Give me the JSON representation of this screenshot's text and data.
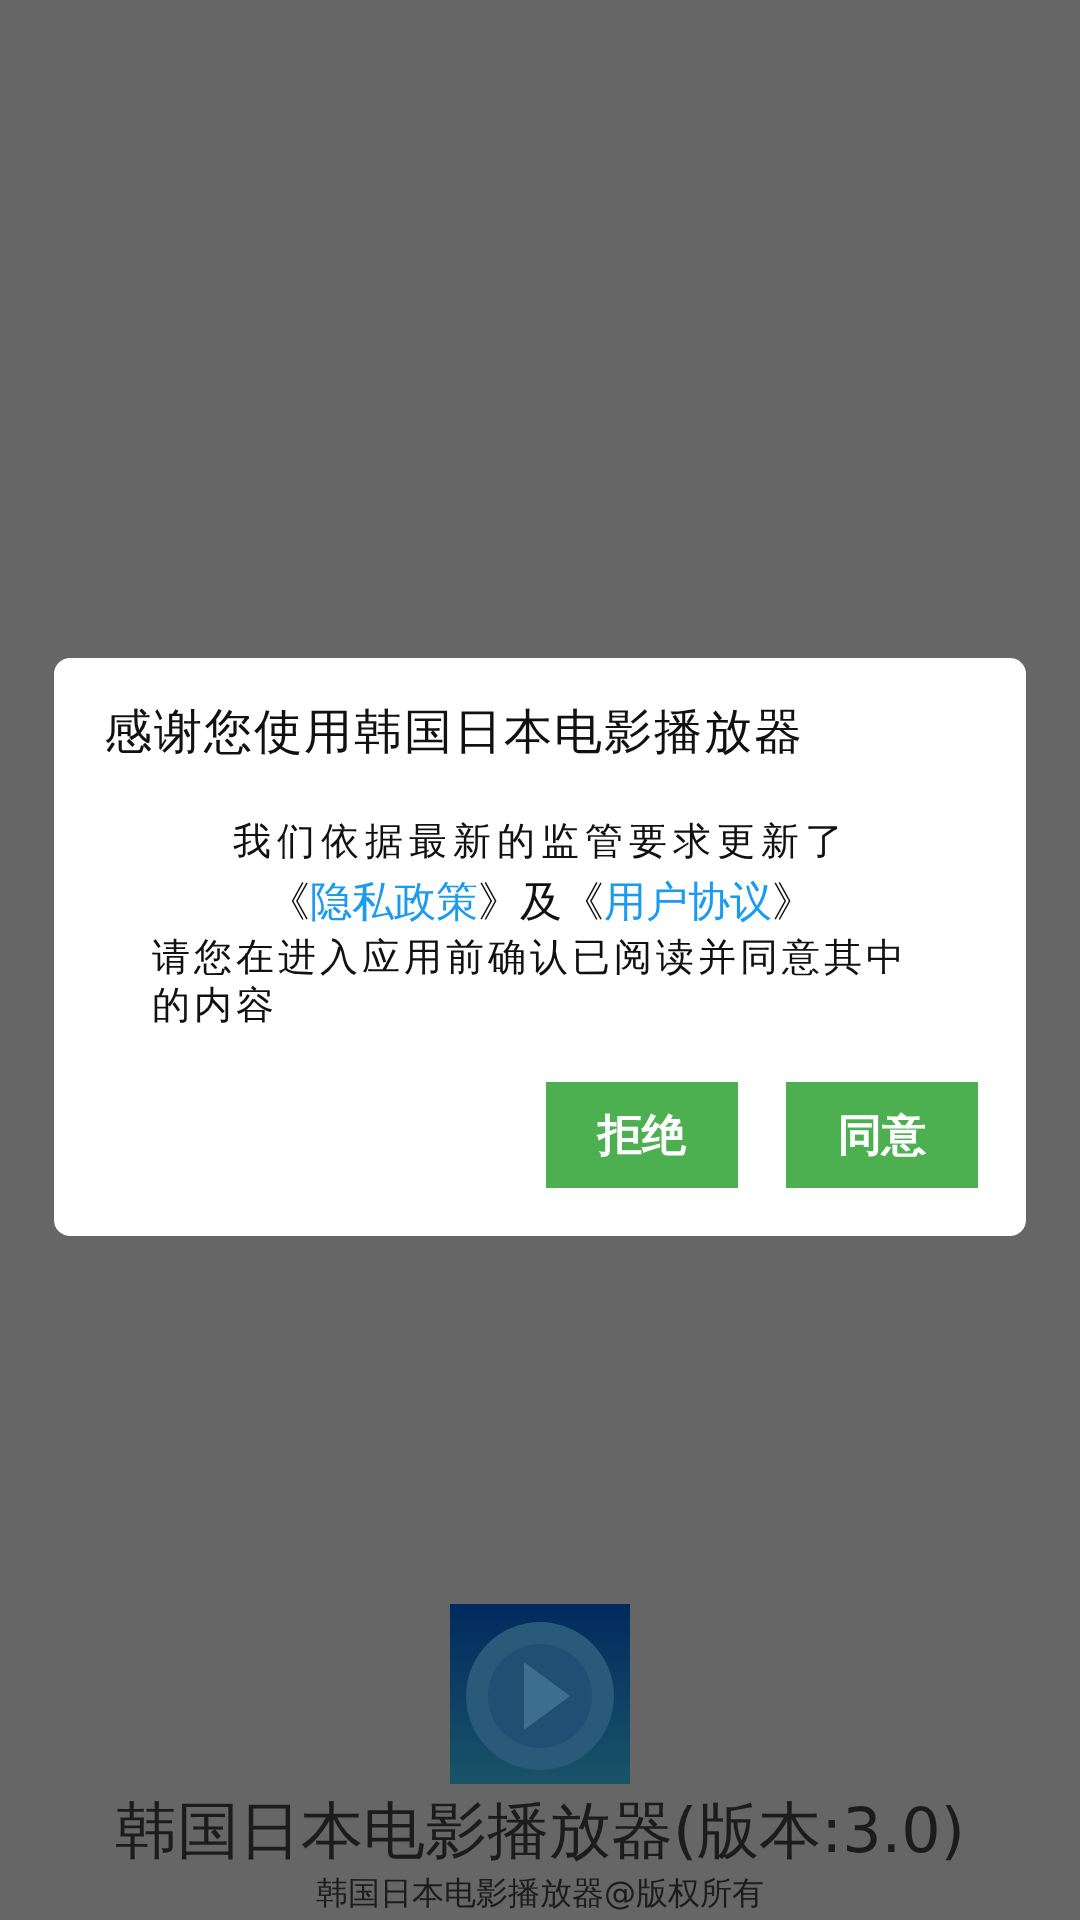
{
  "splash": {
    "app_name": "韩国日本电影播放器(版本:3.0)",
    "copyright": "韩国日本电影播放器@版权所有"
  },
  "dialog": {
    "title": "感谢您使用韩国日本电影播放器",
    "notice": "我们依据最新的监管要求更新了",
    "agreement_line": [
      {
        "kind": "plain",
        "text": "《"
      },
      {
        "kind": "link",
        "text": "隐私政策"
      },
      {
        "kind": "plain",
        "text": "》及《"
      },
      {
        "kind": "link",
        "text": "用户协议"
      },
      {
        "kind": "plain",
        "text": "》"
      }
    ],
    "confirm_text": "请您在进入应用前确认已阅读并同意其中的内容",
    "buttons": [
      {
        "label": "拒绝"
      },
      {
        "label": "同意"
      }
    ]
  }
}
